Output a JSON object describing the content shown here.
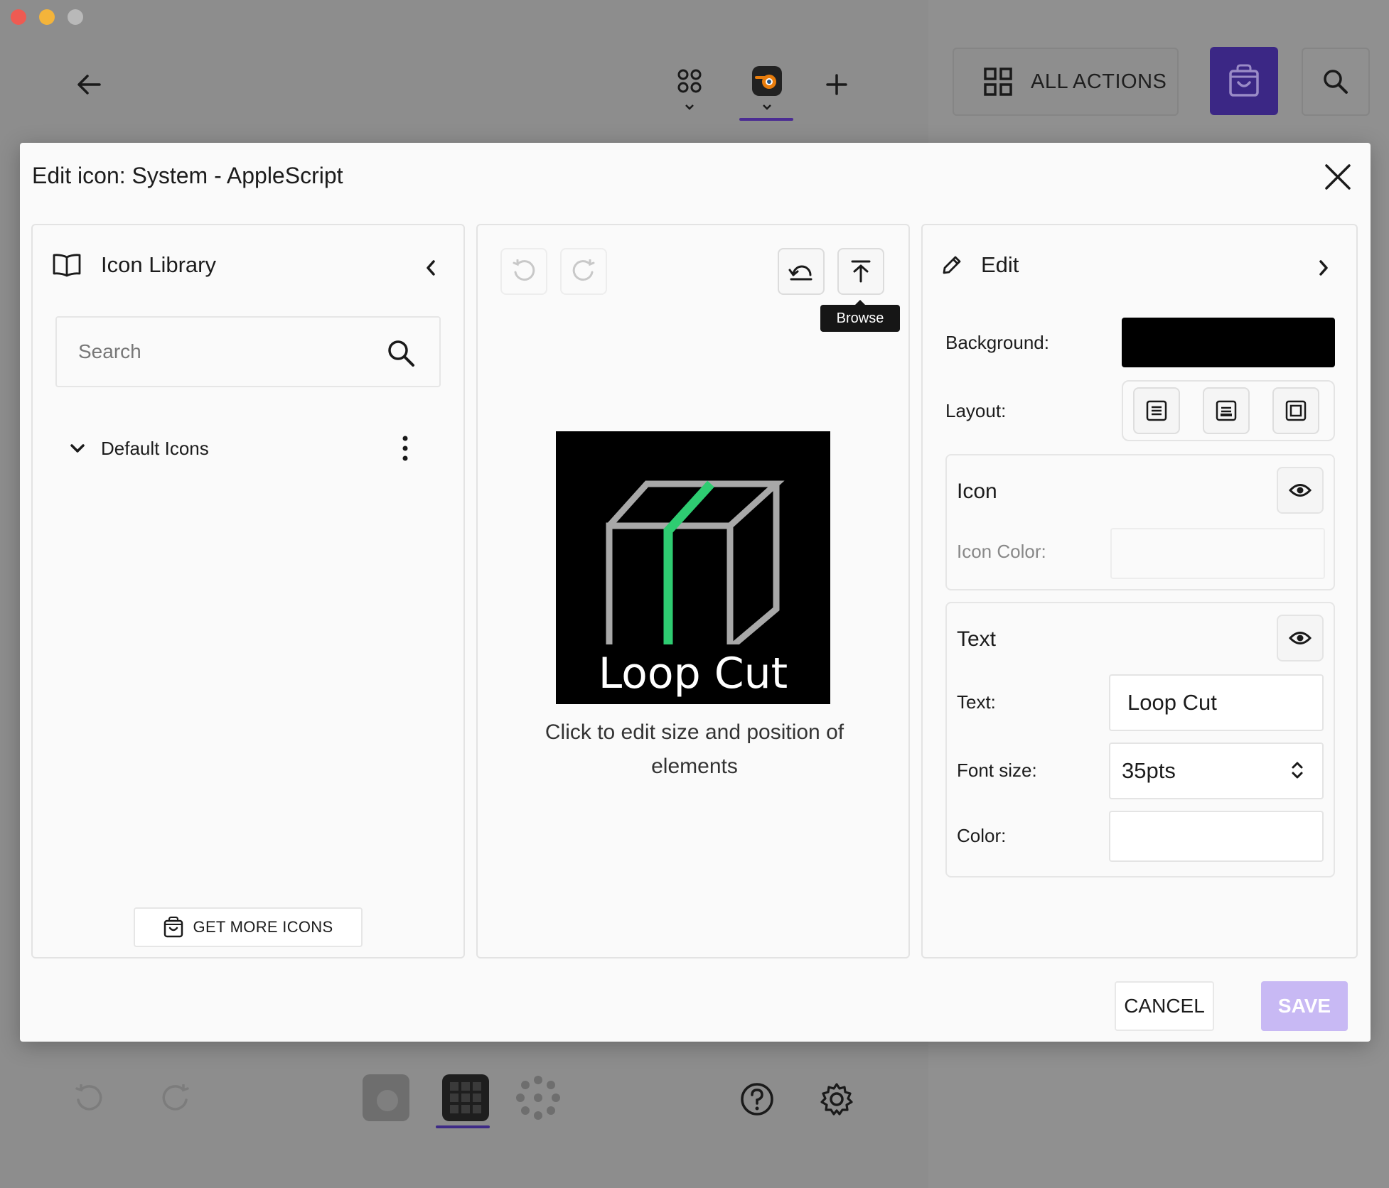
{
  "colors": {
    "accent": "#3b2785",
    "save_disabled": "#c8b9f4",
    "preview_background": "#000000",
    "preview_line": "#a8a8a8",
    "preview_accent": "#2ecc71"
  },
  "toolbar": {
    "all_actions_label": "ALL ACTIONS"
  },
  "modal": {
    "title": "Edit icon: System - AppleScript",
    "library": {
      "title": "Icon Library",
      "search_placeholder": "Search",
      "group_label": "Default Icons",
      "get_more_label": "GET MORE ICONS"
    },
    "canvas": {
      "tooltip": "Browse",
      "preview_text": "Loop Cut",
      "hint": "Click to edit size and position of elements"
    },
    "edit": {
      "title": "Edit",
      "background_label": "Background:",
      "background_color": "#000000",
      "layout_label": "Layout:",
      "icon_section": {
        "title": "Icon",
        "color_label": "Icon Color:"
      },
      "text_section": {
        "title": "Text",
        "text_label": "Text:",
        "text_value": "Loop Cut",
        "font_size_label": "Font size:",
        "font_size_value": "35pts",
        "color_label": "Color:"
      }
    },
    "cancel_label": "CANCEL",
    "save_label": "SAVE"
  }
}
